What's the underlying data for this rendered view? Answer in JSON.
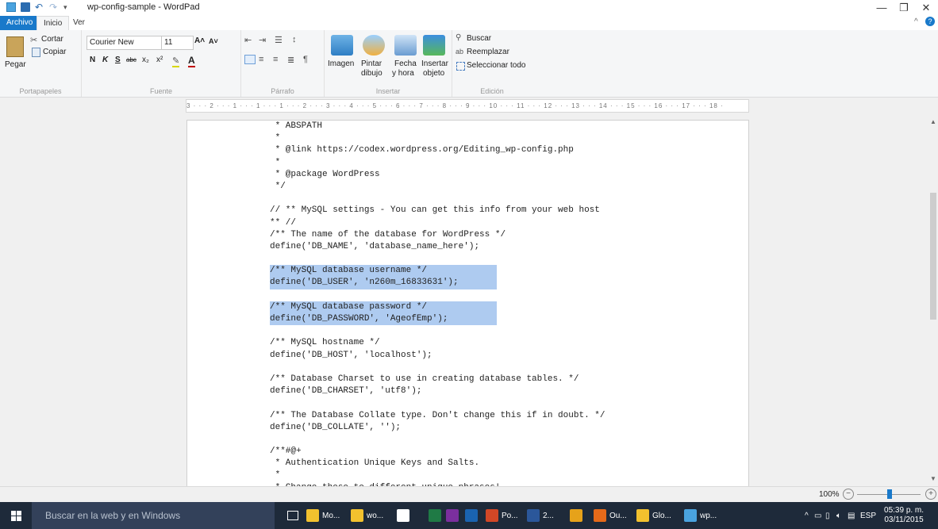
{
  "window": {
    "title": "wp-config-sample - WordPad",
    "controls": {
      "minimize": "—",
      "maximize": "❐",
      "close": "✕"
    }
  },
  "tabs": {
    "file": "Archivo",
    "home": "Inicio",
    "view": "Ver"
  },
  "ribbon": {
    "clipboard": {
      "label": "Portapapeles",
      "paste": "Pegar",
      "cut": "Cortar",
      "copy": "Copiar"
    },
    "font": {
      "label": "Fuente",
      "family": "Courier New",
      "size": "11",
      "bold": "N",
      "italic": "K",
      "underline": "S",
      "strike": "abc",
      "subscript": "x₂",
      "superscript": "x²"
    },
    "paragraph": {
      "label": "Párrafo"
    },
    "insert": {
      "label": "Insertar",
      "image": "Imagen",
      "paint_l1": "Pintar",
      "paint_l2": "dibujo",
      "datetime_l1": "Fecha",
      "datetime_l2": "y hora",
      "object_l1": "Insertar",
      "object_l2": "objeto"
    },
    "editing": {
      "label": "Edición",
      "find": "Buscar",
      "replace": "Reemplazar",
      "select_all": "Seleccionar todo"
    }
  },
  "ruler": {
    "text": "3 · · · 2 · · · 1 · · · 1 · · · 1 · · · 2 · · · 3 · · · 4 · · · 5 · · · 6 · · · 7 · · · 8 · · · 9 · · · 10 · · · 11 · · · 12 · · · 13 · · · 14 · · · 15 · · · 16 · · · 17 · · · 18 ·"
  },
  "document": {
    "lines": [
      {
        "text": " * ABSPATH",
        "highlight": false
      },
      {
        "text": " *",
        "highlight": false
      },
      {
        "text": " * @link https://codex.wordpress.org/Editing_wp-config.php",
        "highlight": false
      },
      {
        "text": " *",
        "highlight": false
      },
      {
        "text": " * @package WordPress",
        "highlight": false
      },
      {
        "text": " */",
        "highlight": false
      },
      {
        "text": "",
        "highlight": false
      },
      {
        "text": "// ** MySQL settings - You can get this info from your web host",
        "highlight": false
      },
      {
        "text": "** //",
        "highlight": false
      },
      {
        "text": "/** The name of the database for WordPress */",
        "highlight": false
      },
      {
        "text": "define('DB_NAME', 'database_name_here');",
        "highlight": false
      },
      {
        "text": "",
        "highlight": false
      },
      {
        "text": "/** MySQL database username */",
        "highlight": true
      },
      {
        "text": "define('DB_USER', 'n260m_16833631');",
        "highlight": true
      },
      {
        "text": "",
        "highlight": true
      },
      {
        "text": "/** MySQL database password */",
        "highlight": true
      },
      {
        "text": "define('DB_PASSWORD', 'AgeofEmp');",
        "highlight": true
      },
      {
        "text": "",
        "highlight": false
      },
      {
        "text": "/** MySQL hostname */",
        "highlight": false
      },
      {
        "text": "define('DB_HOST', 'localhost');",
        "highlight": false
      },
      {
        "text": "",
        "highlight": false
      },
      {
        "text": "/** Database Charset to use in creating database tables. */",
        "highlight": false
      },
      {
        "text": "define('DB_CHARSET', 'utf8');",
        "highlight": false
      },
      {
        "text": "",
        "highlight": false
      },
      {
        "text": "/** The Database Collate type. Don't change this if in doubt. */",
        "highlight": false
      },
      {
        "text": "define('DB_COLLATE', '');",
        "highlight": false
      },
      {
        "text": "",
        "highlight": false
      },
      {
        "text": "/**#@+",
        "highlight": false
      },
      {
        "text": " * Authentication Unique Keys and Salts.",
        "highlight": false
      },
      {
        "text": " *",
        "highlight": false
      },
      {
        "text": " * Change these to different unique phrases!",
        "highlight": false
      }
    ]
  },
  "status": {
    "zoom": "100%"
  },
  "taskbar": {
    "search_placeholder": "Buscar en la web y en Windows",
    "items": [
      {
        "label": "Mo...",
        "icon": "folder-icon",
        "color": "#f2c12e"
      },
      {
        "label": "wo...",
        "icon": "folder-icon",
        "color": "#f2c12e"
      },
      {
        "label": "",
        "icon": "store-icon",
        "color": "#ffffff"
      },
      {
        "label": "",
        "icon": "excel-icon",
        "color": "#1f7a45"
      },
      {
        "label": "",
        "icon": "onenote-icon",
        "color": "#7b2f9e"
      },
      {
        "label": "",
        "icon": "outlook-icon",
        "color": "#1a63b0"
      },
      {
        "label": "Po...",
        "icon": "powerpoint-icon",
        "color": "#d24726"
      },
      {
        "label": "2...",
        "icon": "word-icon",
        "color": "#2b579a"
      },
      {
        "label": "",
        "icon": "chrome-icon",
        "color": "#e6a21a"
      },
      {
        "label": "Ou...",
        "icon": "firefox-icon",
        "color": "#e66a1a"
      },
      {
        "label": "Glo...",
        "icon": "app-icon",
        "color": "#f2c12e"
      },
      {
        "label": "wp...",
        "icon": "wordpad-icon",
        "color": "#4aa3df"
      }
    ],
    "language": "ESP",
    "time": "05:39 p. m.",
    "date": "03/11/2015"
  }
}
